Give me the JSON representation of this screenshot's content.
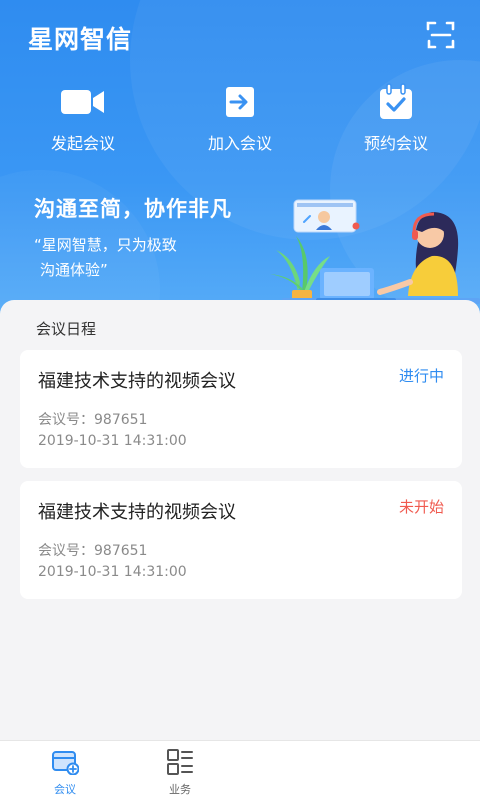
{
  "header": {
    "app_title": "星网智信",
    "scan_icon": "scan-icon"
  },
  "actions": [
    {
      "label": "发起会议",
      "icon": "video-camera-icon"
    },
    {
      "label": "加入会议",
      "icon": "enter-arrow-icon"
    },
    {
      "label": "预约会议",
      "icon": "calendar-check-icon"
    }
  ],
  "banner": {
    "slogan": "沟通至简，协作非凡",
    "tagline_line1": "“星网智慧，只为极致",
    "tagline_line2": "沟通体验”"
  },
  "schedule": {
    "title": "会议日程",
    "meetings": [
      {
        "title": "福建技术支持的视频会议",
        "status": "进行中",
        "meeting_id_text": "会议号：987651",
        "datetime": "2019-10-31  14:31:00"
      },
      {
        "title": "福建技术支持的视频会议",
        "status": "未开始",
        "meeting_id_text": "会议号：987651",
        "datetime": "2019-10-31  14:31:00"
      }
    ]
  },
  "tabs": [
    {
      "label": "会议",
      "icon": "meeting-add-icon",
      "active": true
    },
    {
      "label": "业务",
      "icon": "grid-list-icon",
      "active": false
    }
  ],
  "colors": {
    "primary": "#2f8cf0",
    "pending": "#f05a4f"
  }
}
